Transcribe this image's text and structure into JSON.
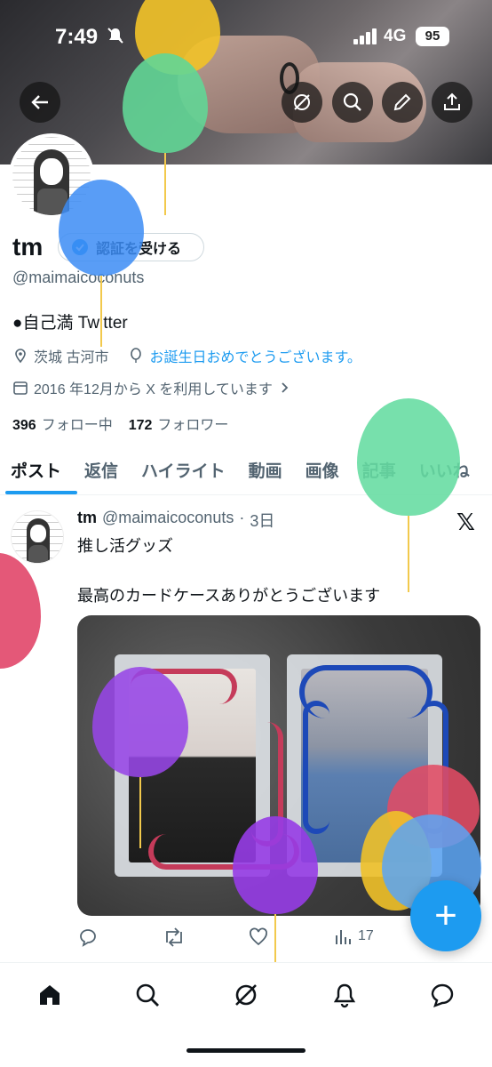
{
  "status_bar": {
    "time": "7:49",
    "network": "4G",
    "battery": "95"
  },
  "profile": {
    "name": "tm",
    "verify_label": "認証を受ける",
    "handle": "@maimaicoconuts",
    "bio": "●自己満 Twitter",
    "location": "茨城 古河市",
    "birthday_text": "お誕生日おめでとうございます。",
    "joined": "2016 年12月から X を利用しています",
    "following_count": "396",
    "following_label": "フォロー中",
    "followers_count": "172",
    "followers_label": "フォロワー"
  },
  "tabs": [
    "ポスト",
    "返信",
    "ハイライト",
    "動画",
    "画像",
    "記事",
    "いいね"
  ],
  "post": {
    "author": "tm",
    "handle": "@maimaicoconuts",
    "time": "3日",
    "line1": "推し活グッズ",
    "line2": "最高のカードケースありがとうございます",
    "views": "17"
  },
  "colors": {
    "accent": "#1d9bf0",
    "text": "#0f1419",
    "muted": "#536471"
  },
  "icons": {
    "header": [
      "back-arrow-icon",
      "grok-icon",
      "search-icon",
      "edit-icon",
      "share-icon"
    ],
    "bottom_nav": [
      "home-icon",
      "search-icon",
      "grok-icon",
      "bell-icon",
      "chat-icon"
    ]
  }
}
